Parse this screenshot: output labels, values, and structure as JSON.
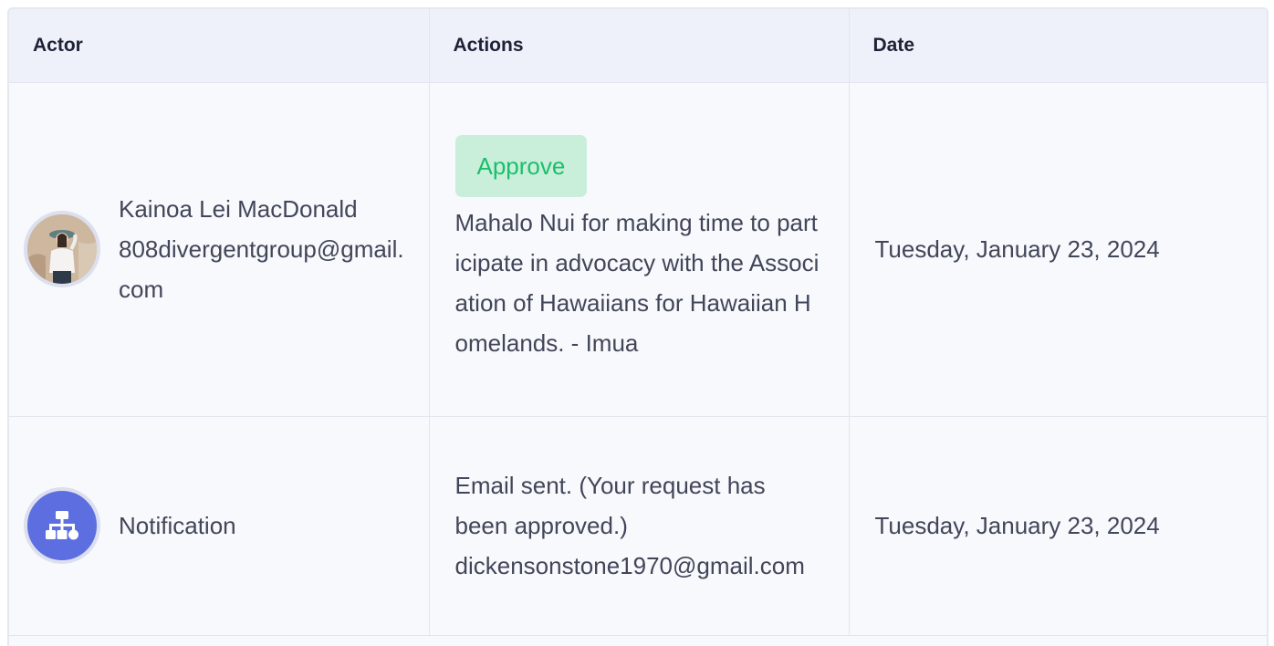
{
  "headers": {
    "actor": "Actor",
    "actions": "Actions",
    "date": "Date"
  },
  "rows": [
    {
      "actor_name": "Kainoa Lei MacDonald",
      "actor_email": "808divergentgroup@gmail.com",
      "avatar_icon": "user-photo-avatar",
      "action_badge": "Approve",
      "action_text": "Mahalo Nui for making time to participate in advocacy with the Association of Hawaiians for Hawaiian Homelands. - Imua",
      "date": "Tuesday, January 23, 2024"
    },
    {
      "actor_name": "Notification",
      "avatar_icon": "sitemap-icon",
      "action_text_line1": "Email sent. (Your request has been approved.)",
      "action_text_line2": "dickensonstone1970@gmail.com",
      "date": "Tuesday, January 23, 2024"
    }
  ],
  "colors": {
    "approve_bg": "#c9efdb",
    "approve_text": "#1bbf6a",
    "notification_avatar": "#5d6fe0",
    "header_bg": "#eef0fa"
  }
}
